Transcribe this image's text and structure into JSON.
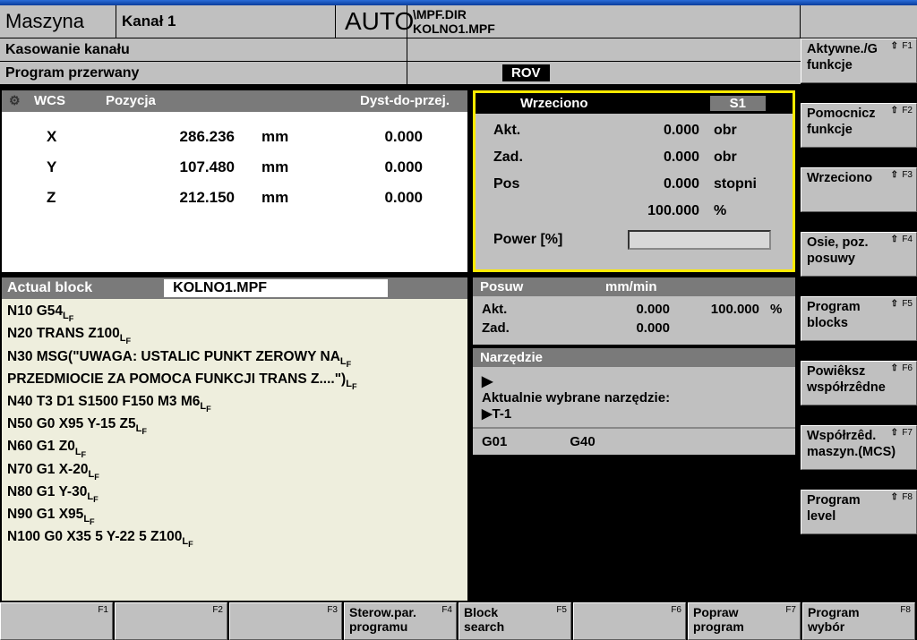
{
  "header": {
    "machine": "Maszyna",
    "channel": "Kanał 1",
    "mode": "AUTO",
    "path_line1": "\\MPF.DIR",
    "path_line2": "KOLNO1.MPF",
    "msg1": "Kasowanie kanału",
    "msg2": "Program przerwany",
    "rov": "ROV"
  },
  "axis": {
    "hdr_wcs": "WCS",
    "hdr_pos": "Pozycja",
    "hdr_dist": "Dyst-do-przej.",
    "rows": [
      {
        "name": "X",
        "pos": "286.236",
        "unit": "mm",
        "dist": "0.000"
      },
      {
        "name": "Y",
        "pos": "107.480",
        "unit": "mm",
        "dist": "0.000"
      },
      {
        "name": "Z",
        "pos": "212.150",
        "unit": "mm",
        "dist": "0.000"
      }
    ]
  },
  "spindle": {
    "title": "Wrzeciono",
    "badge": "S1",
    "rows": [
      {
        "label": "Akt.",
        "value": "0.000",
        "unit": "obr"
      },
      {
        "label": "Zad.",
        "value": "0.000",
        "unit": "obr"
      },
      {
        "label": "Pos",
        "value": "0.000",
        "unit": "stopni"
      },
      {
        "label": "",
        "value": "100.000",
        "unit": "%"
      }
    ],
    "power_label": "Power [%]"
  },
  "prog": {
    "header": "Actual block",
    "name": "KOLNO1.MPF",
    "lines": [
      "N10 G54",
      "N20 TRANS Z100",
      "N30 MSG(\"UWAGA: USTALIC PUNKT ZEROWY NA",
      "PRZEDMIOCIE ZA POMOCA FUNKCJI TRANS Z....\")",
      "N40 T3 D1 S1500 F150 M3 M6",
      "N50 G0 X95 Y-15 Z5",
      "N60 G1 Z0",
      "N70 G1 X-20",
      "N80 G1 Y-30",
      "N90 G1 X95",
      "N100 G0 X35 5 Y-22 5 Z100"
    ]
  },
  "feed": {
    "title": "Posuw",
    "unit_hdr": "mm/min",
    "rows": [
      {
        "label": "Akt.",
        "v1": "0.000",
        "v2": "100.000",
        "u": "%"
      },
      {
        "label": "Zad.",
        "v1": "0.000",
        "v2": "",
        "u": ""
      }
    ]
  },
  "tool": {
    "title": "Narzędzie",
    "line1": "Aktualnie wybrane narzędzie:",
    "line2": "T-1",
    "g1": "G01",
    "g2": "G40"
  },
  "vsoft": [
    {
      "label": "Aktywne./G\nfunkcje",
      "fkey": "F1"
    },
    {
      "label": "Pomocnicz\nfunkcje",
      "fkey": "F2"
    },
    {
      "label": "Wrzeciono",
      "fkey": "F3"
    },
    {
      "label": "Osie, poz.\nposuwy",
      "fkey": "F4"
    },
    {
      "label": "Program\nblocks",
      "fkey": "F5"
    },
    {
      "label": "Powiêksz\nwspółrzêdne",
      "fkey": "F6"
    },
    {
      "label": "Współrzêd.\nmaszyn.(MCS)",
      "fkey": "F7"
    },
    {
      "label": "Program\nlevel",
      "fkey": "F8"
    }
  ],
  "hsoft": [
    {
      "label": "",
      "fkey": "F1"
    },
    {
      "label": "",
      "fkey": "F2"
    },
    {
      "label": "",
      "fkey": "F3"
    },
    {
      "label": "Sterow.par.\nprogramu",
      "fkey": "F4"
    },
    {
      "label": "Block\nsearch",
      "fkey": "F5"
    },
    {
      "label": "",
      "fkey": "F6"
    },
    {
      "label": "Popraw\nprogram",
      "fkey": "F7"
    },
    {
      "label": "Program\nwybór",
      "fkey": "F8"
    }
  ]
}
